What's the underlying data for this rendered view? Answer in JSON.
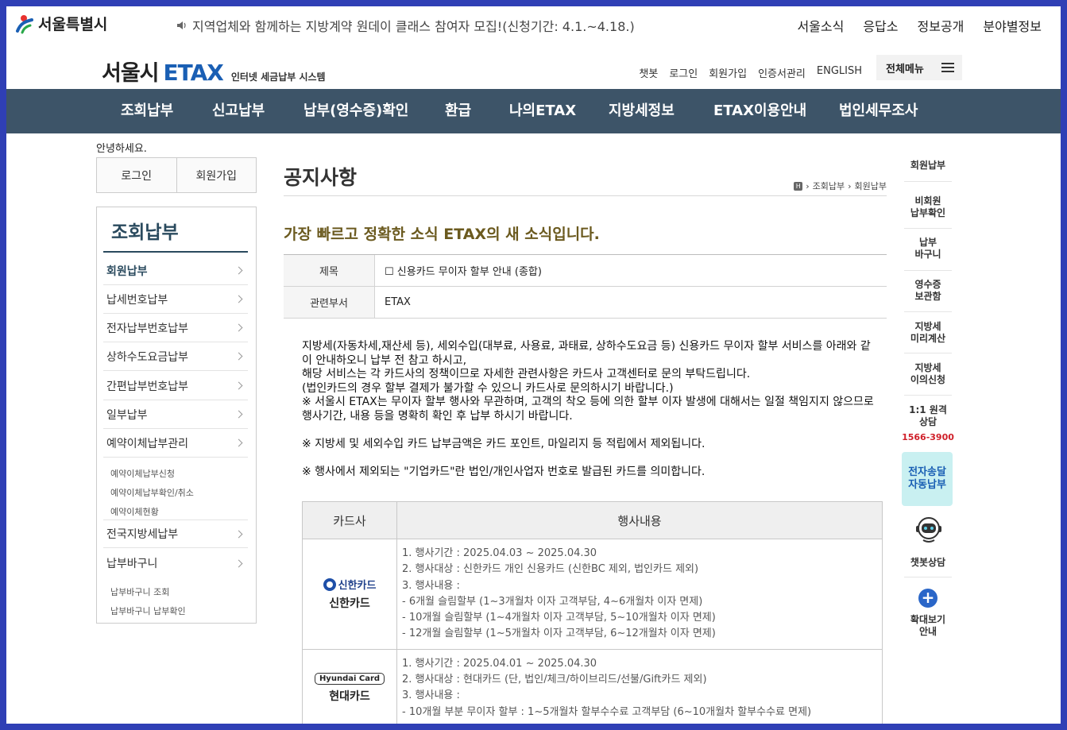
{
  "gov": {
    "logo_text": "서울특별시",
    "notice": "지역업체와 함께하는 지방계약 원데이 클래스 참여자 모집!(신청기간: 4.1.~4.18.)",
    "links": [
      "서울소식",
      "응답소",
      "정보공개",
      "분야별정보"
    ]
  },
  "header": {
    "logo_seoul": "서울시",
    "logo_etax": "ETAX",
    "logo_sub": "인터넷 세금납부 시스템",
    "util_links": [
      "챗봇",
      "로그인",
      "회원가입",
      "인증서관리",
      "ENGLISH"
    ],
    "all_menu": "전체메뉴"
  },
  "gnb": [
    "조회납부",
    "신고납부",
    "납부(영수증)확인",
    "환급",
    "나의ETAX",
    "지방세정보",
    "ETAX이용안내",
    "법인세무조사"
  ],
  "left": {
    "greeting": "안녕하세요.",
    "login": "로그인",
    "join": "회원가입",
    "lnb_title": "조회납부",
    "items": [
      "회원납부",
      "납세번호납부",
      "전자납부번호납부",
      "상하수도요금납부",
      "간편납부번호납부",
      "일부납부",
      "예약이체납부관리",
      "전국지방세납부",
      "납부바구니"
    ],
    "sub_reserve": [
      "예약이체납부신청",
      "예약이체납부확인/취소",
      "예약이체현황"
    ],
    "sub_basket": [
      "납부바구니 조회",
      "납부바구니 납부확인"
    ]
  },
  "content": {
    "title": "공지사항",
    "breadcrumb": [
      "조회납부",
      "회원납부"
    ],
    "subhead": "가장 빠르고 정확한 소식 ETAX의 새 소식입니다.",
    "info": [
      {
        "label": "제목",
        "value": "☐ 신용카드 무이자 할부 안내 (종합)"
      },
      {
        "label": "관련부서",
        "value": "ETAX"
      }
    ],
    "body": [
      "지방세(자동차세,재산세 등), 세외수입(대부료, 사용료, 과태료, 상하수도요금 등) 신용카드 무이자 할부 서비스를 아래와 같이 안내하오니 납부 전 참고 하시고,",
      "해당 서비스는 각 카드사의 정책이므로 자세한 관련사항은 카드사 고객센터로 문의 부탁드립니다.",
      "(법인카드의 경우 할부 결제가 불가할 수 있으니 카드사로 문의하시기 바랍니다.)",
      "※ 서울시 ETAX는 무이자 할부 행사와 무관하며, 고객의 착오 등에 의한 할부 이자 발생에 대해서는 일절 책임지지 않으므로 행사기간, 내용 등을 명확히 확인 후 납부 하시기 바랍니다.",
      "",
      "※ 지방세 및 세외수입 카드 납부금액은 카드 포인트, 마일리지 등 적립에서 제외됩니다.",
      "",
      "※ 행사에서 제외되는 \"기업카드\"란 법인/개인사업자 번호로 발급된 카드를 의미합니다."
    ],
    "card_table": {
      "headers": [
        "카드사",
        "행사내용"
      ],
      "rows": [
        {
          "logo_text": "신한카드",
          "name": "신한카드",
          "lines": [
            "1. 행사기간 : 2025.04.03 ~ 2025.04.30",
            "2. 행사대상 : 신한카드 개인 신용카드 (신한BC 제외, 법인카드 제외)",
            "3. 행사내용 :",
            "- 6개월 슬림할부 (1~3개월차 이자 고객부담, 4~6개월차 이자 면제)",
            "- 10개월 슬림할부 (1~4개월차 이자 고객부담, 5~10개월차 이자 면제)",
            "- 12개월 슬림할부 (1~5개월차 이자 고객부담, 6~12개월차 이자 면제)"
          ]
        },
        {
          "logo_text": "Hyundai Card",
          "name": "현대카드",
          "lines": [
            "1. 행사기간 : 2025.04.01 ~ 2025.04.30",
            "2. 행사대상 : 현대카드 (단, 법인/체크/하이브리드/선불/Gift카드 제외)",
            "3. 행사내용 :",
            "- 10개월 부분 무이자 할부 : 1~5개월차 할부수수료 고객부담 (6~10개월차 할부수수료 면제)"
          ]
        }
      ]
    }
  },
  "quick": {
    "items": [
      "회원납부",
      "비회원\n납부확인",
      "납부\n바구니",
      "영수증\n보관함",
      "지방세\n미리계산",
      "지방세\n이의신청",
      "1:1 원격\n상담"
    ],
    "phone": "1566-3900",
    "auto": "전자송달\n자동납부",
    "chatbot": "챗봇상담",
    "zoom": "확대보기\n안내"
  }
}
